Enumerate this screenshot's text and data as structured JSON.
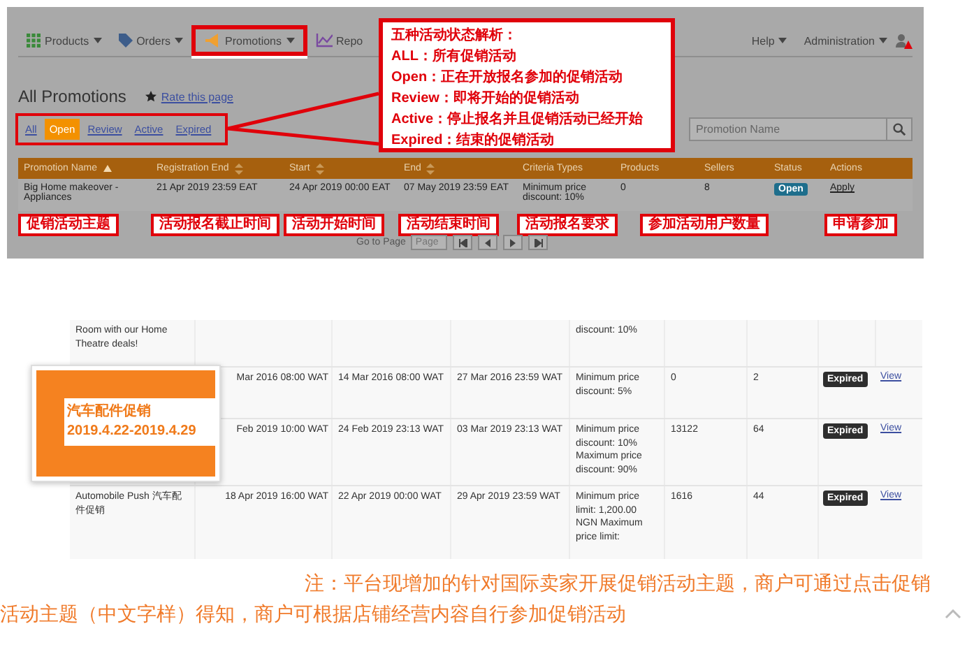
{
  "nav": {
    "items": [
      {
        "kind": "products",
        "label": "Products",
        "selected": false
      },
      {
        "kind": "orders",
        "label": "Orders",
        "selected": false
      },
      {
        "kind": "promotions",
        "label": "Promotions",
        "selected": true
      },
      {
        "kind": "reports",
        "label": "Repo",
        "selected": false
      }
    ],
    "right": [
      {
        "label": "Help"
      },
      {
        "label": "Administration"
      }
    ]
  },
  "page_title": "All Promotions",
  "rate_link": "Rate this page",
  "filters": [
    {
      "label": "All",
      "selected": false
    },
    {
      "label": "Open",
      "selected": true
    },
    {
      "label": "Review",
      "selected": false
    },
    {
      "label": "Active",
      "selected": false
    },
    {
      "label": "Expired",
      "selected": false
    }
  ],
  "search": {
    "placeholder": "Promotion Name"
  },
  "table": {
    "columns": [
      {
        "label": "Promotion Name",
        "sorted": true,
        "sortable": true
      },
      {
        "label": "Registration End",
        "sorted": false,
        "sortable": true
      },
      {
        "label": "Start",
        "sorted": false,
        "sortable": true
      },
      {
        "label": "End",
        "sorted": false,
        "sortable": true
      },
      {
        "label": "Criteria Types",
        "sorted": false,
        "sortable": false
      },
      {
        "label": "Products",
        "sorted": false,
        "sortable": false
      },
      {
        "label": "Sellers",
        "sorted": false,
        "sortable": false
      },
      {
        "label": "Status",
        "sorted": false,
        "sortable": false
      },
      {
        "label": "Actions",
        "sorted": false,
        "sortable": false
      }
    ],
    "rows": [
      {
        "cells": [
          "Big Home makeover - Appliances",
          "21 Apr 2019 23:59 EAT",
          "24 Apr 2019 00:00 EAT",
          "07 May 2019 23:59 EAT",
          "Minimum price discount: 10%",
          "0",
          "8"
        ],
        "status": {
          "text": "Open",
          "kind": "open"
        },
        "action": "Apply"
      }
    ]
  },
  "annotations": [
    "促销活动主题",
    "活动报名截止时间",
    "活动开始时间",
    "活动结束时间",
    "活动报名要求",
    "参加活动用户数量",
    "申请参加"
  ],
  "pagination": {
    "label": "Go to Page",
    "placeholder": "Page"
  },
  "callout": {
    "title": "五种活动状态解析：",
    "lines": [
      "ALL：所有促销活动",
      "Open：正在开放报名参加的促销活动",
      "Review：即将开始的促销活动",
      "Active：停止报名并且促销活动已经开始",
      "Expired：结束的促销活动"
    ]
  },
  "second_table": {
    "rows": [
      {
        "cells": [
          "Room with our Home Theatre deals!",
          null,
          null,
          null,
          "discount: 10%",
          null,
          null
        ]
      },
      {
        "cells": [
          null,
          "Mar 2016 08:00 WAT",
          "14 Mar 2016 08:00 WAT",
          "27 Mar 2016 23:59 WAT",
          "Minimum price discount: 5%",
          "0",
          "2"
        ],
        "status": {
          "text": "Expired",
          "kind": "expired"
        },
        "action": "View"
      },
      {
        "cells": [
          null,
          "Feb 2019 10:00 WAT",
          "24 Feb 2019 23:13 WAT",
          "03 Mar 2019 23:13 WAT",
          "Minimum price discount: 10% Maximum price discount: 90%",
          "13122",
          "64"
        ],
        "status": {
          "text": "Expired",
          "kind": "expired"
        },
        "action": "View"
      },
      {
        "cells": [
          "Automobile Push 汽车配件促销",
          "18 Apr 2019 16:00 WAT",
          "22 Apr 2019 00:00 WAT",
          "29 Apr 2019 23:59 WAT",
          "Minimum price limit: 1,200.00 NGN Maximum price limit:",
          "1616",
          "44"
        ],
        "status": {
          "text": "Expired",
          "kind": "expired"
        },
        "action": "View"
      }
    ],
    "popup": {
      "title": "汽车配件促销",
      "dates": "2019.4.22-2019.4.29"
    }
  },
  "note": "注：平台现增加的针对国际卖家开展促销活动主题，商户可通过点击促销活动主题（中文字样）得知，商户可根据店铺经营内容自行参加促销活动"
}
